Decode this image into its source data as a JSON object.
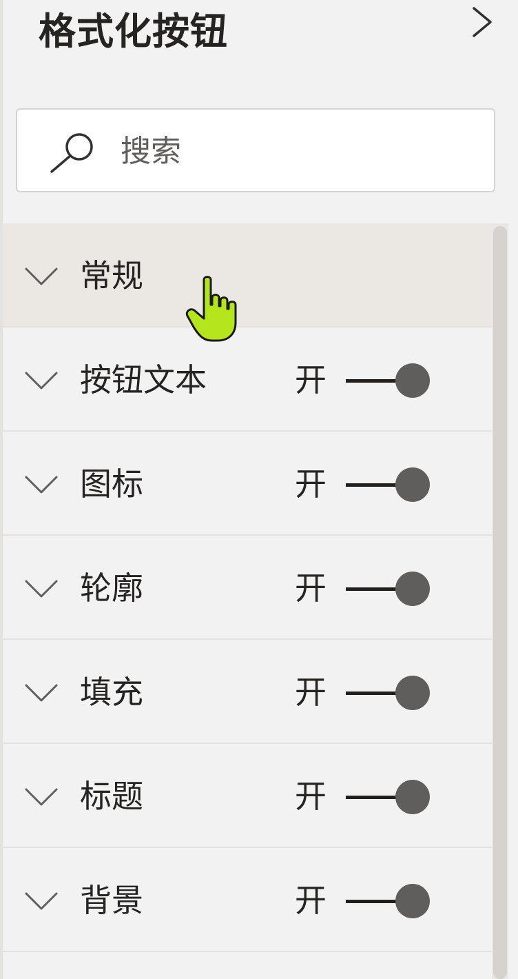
{
  "header": {
    "title": "格式化按钮",
    "expand_icon": "chevron-right-icon"
  },
  "search": {
    "placeholder": "搜索",
    "value": "",
    "icon": "search-icon"
  },
  "sections": [
    {
      "label": "常规",
      "toggle": null
    },
    {
      "label": "按钮文本",
      "state": "开",
      "toggle": "on"
    },
    {
      "label": "图标",
      "state": "开",
      "toggle": "on"
    },
    {
      "label": "轮廓",
      "state": "开",
      "toggle": "on"
    },
    {
      "label": "填充",
      "state": "开",
      "toggle": "on"
    },
    {
      "label": "标题",
      "state": "开",
      "toggle": "on"
    },
    {
      "label": "背景",
      "state": "开",
      "toggle": "on"
    }
  ],
  "colors": {
    "background": "#f2f2f3",
    "hover_row": "#ebe8e4",
    "toggle_knob": "#605e5c",
    "cursor": "#b5e61d"
  }
}
